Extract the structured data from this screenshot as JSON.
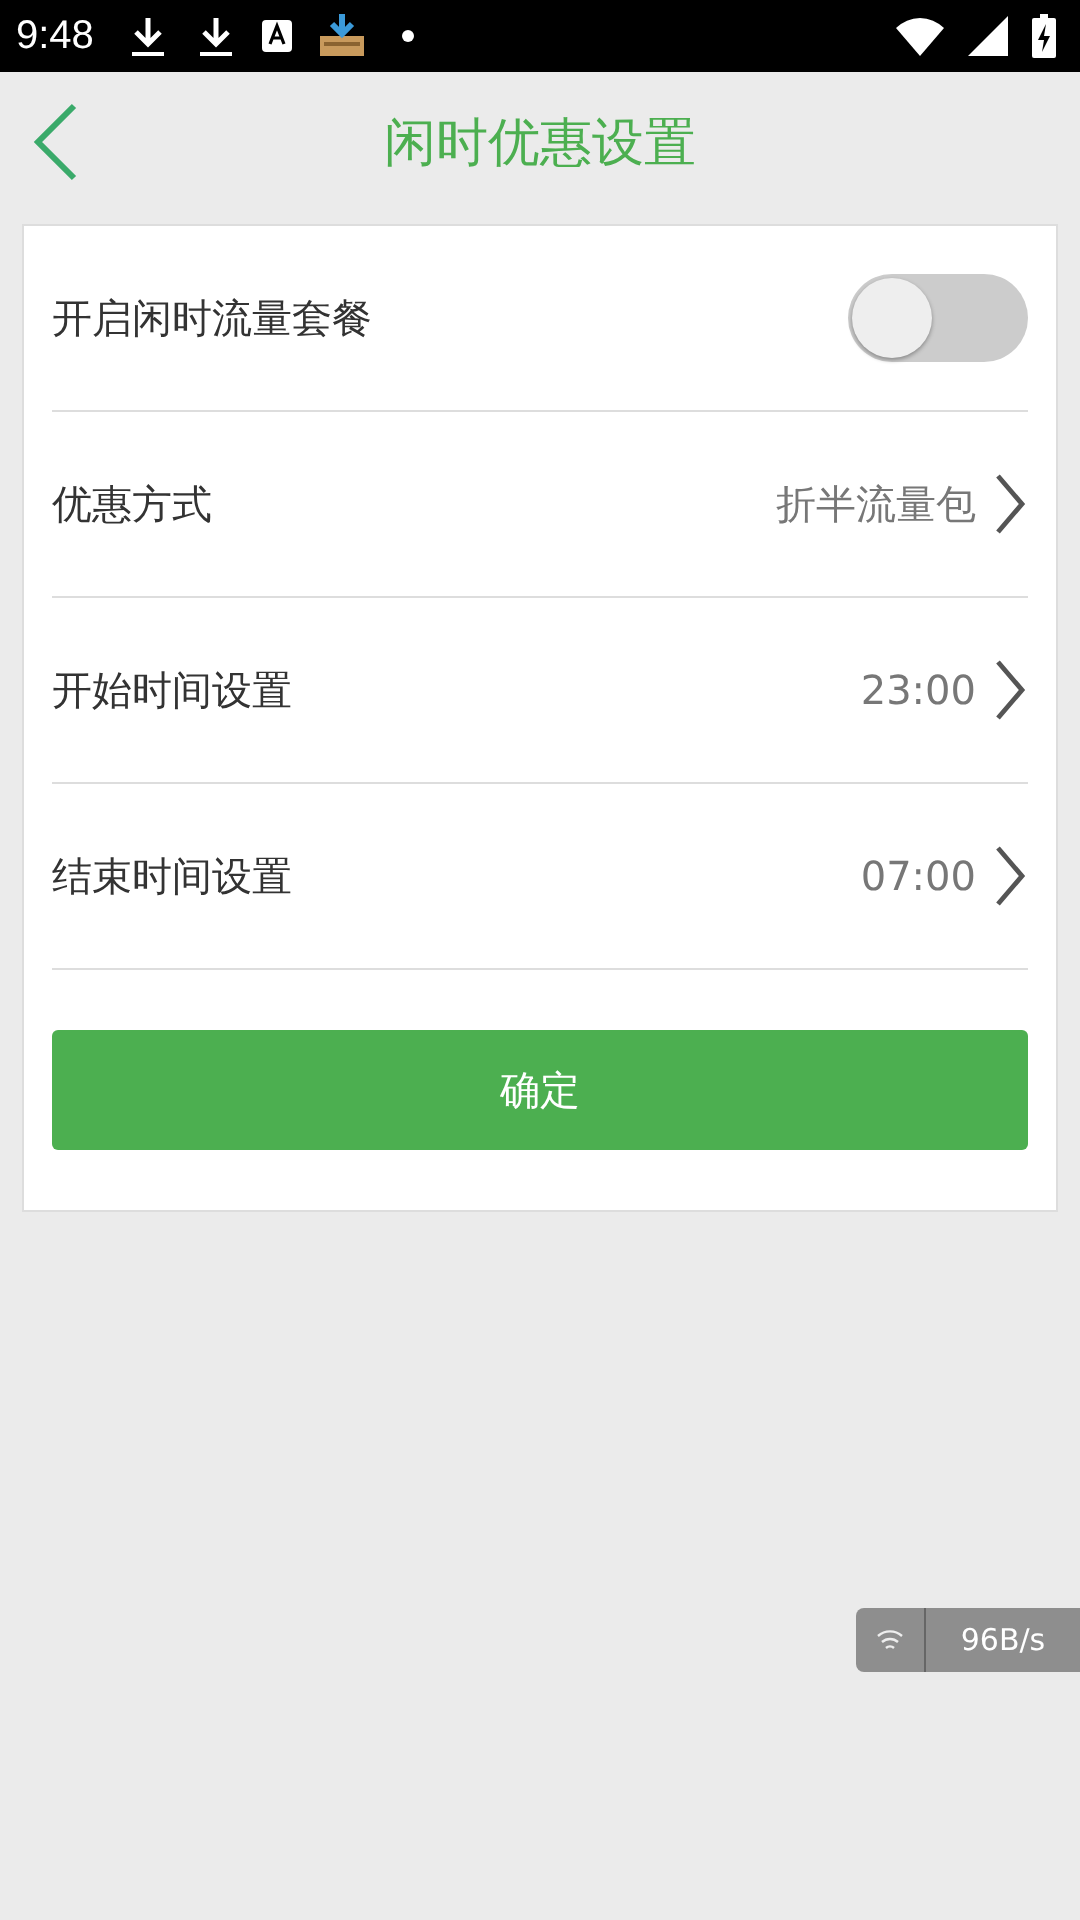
{
  "status_bar": {
    "time": "9:48"
  },
  "header": {
    "title": "闲时优惠设置"
  },
  "settings": [
    {
      "kind": "toggle",
      "label": "开启闲时流量套餐",
      "on": false
    },
    {
      "kind": "link",
      "label": "优惠方式",
      "value": "折半流量包"
    },
    {
      "kind": "link",
      "label": "开始时间设置",
      "value": "23:00"
    },
    {
      "kind": "link",
      "label": "结束时间设置",
      "value": "07:00"
    }
  ],
  "confirm_button": "确定",
  "speed_widget": {
    "speed": "96B/s"
  }
}
